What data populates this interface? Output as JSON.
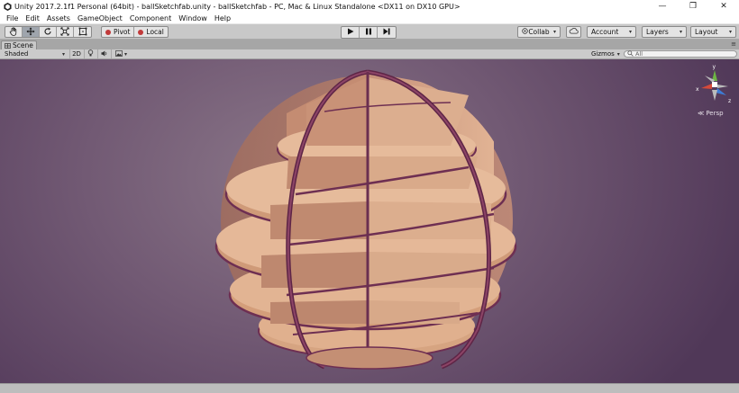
{
  "window": {
    "title": "Unity 2017.2.1f1 Personal (64bit) - ballSketchfab.unity - ballSketchfab - PC, Mac & Linux Standalone <DX11 on DX10 GPU>",
    "minimize": "—",
    "maximize": "❐",
    "close": "✕"
  },
  "menu": [
    "File",
    "Edit",
    "Assets",
    "GameObject",
    "Component",
    "Window",
    "Help"
  ],
  "toolbar": {
    "tools": [
      "hand-icon",
      "move-icon",
      "rotate-icon",
      "scale-icon",
      "rect-icon"
    ],
    "pivot_label": "Pivot",
    "local_label": "Local",
    "collab_label": "Collab",
    "account_label": "Account",
    "layers_label": "Layers",
    "layout_label": "Layout",
    "caret": "▾"
  },
  "scene": {
    "tab_label": "Scene",
    "shading_mode": "Shaded",
    "mode_2d": "2D",
    "gizmos_label": "Gizmos",
    "search_placeholder": "All",
    "persp_label": "Persp"
  },
  "gizmo_axes": {
    "y": "y",
    "x": "x",
    "z": "z"
  },
  "colors": {
    "viewport_bg": "#725a74",
    "wood": "#d6a17c",
    "edge": "#6e2f52"
  }
}
